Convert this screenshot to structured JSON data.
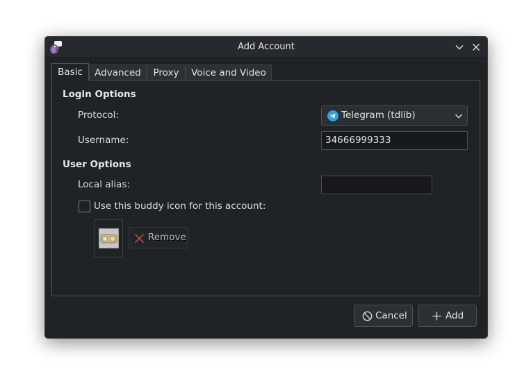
{
  "window": {
    "title": "Add Account",
    "app_icon": "pidgin-icon",
    "controls": {
      "minimize_icon": "chevron-down-icon",
      "close_icon": "close-icon"
    }
  },
  "tabs": [
    {
      "label": "Basic",
      "active": true
    },
    {
      "label": "Advanced",
      "active": false
    },
    {
      "label": "Proxy",
      "active": false
    },
    {
      "label": "Voice and Video",
      "active": false
    }
  ],
  "login_options": {
    "heading": "Login Options",
    "protocol_label": "Protocol:",
    "protocol_value": "Telegram (tdlib)",
    "protocol_icon": "telegram-icon",
    "username_label": "Username:",
    "username_value": "34666999333"
  },
  "user_options": {
    "heading": "User Options",
    "local_alias_label": "Local alias:",
    "local_alias_value": "",
    "buddy_icon_checkbox_label": "Use this buddy icon for this account:",
    "buddy_icon_checked": false,
    "remove_label": "Remove",
    "remove_icon": "x-icon"
  },
  "footer": {
    "cancel_label": "Cancel",
    "cancel_icon": "cancel-icon",
    "add_label": "Add",
    "add_icon": "plus-icon"
  },
  "colors": {
    "window_bg": "#202326",
    "titlebar_bg": "#26292d",
    "telegram_blue": "#2aa3df",
    "remove_x_red": "#d9534f"
  }
}
